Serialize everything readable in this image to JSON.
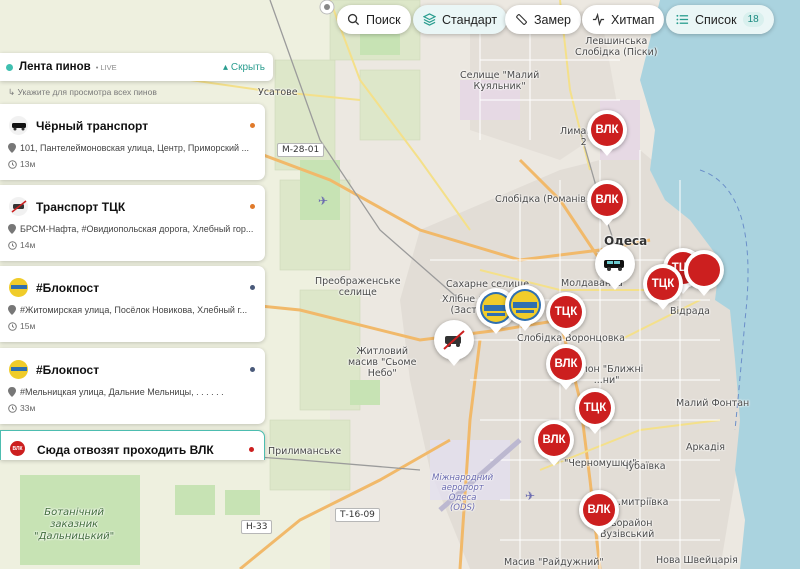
{
  "toolbar": {
    "search_label": "Поиск",
    "standard_label": "Стандарт",
    "measure_label": "Замер",
    "heatmap_label": "Хитмап",
    "list_label": "Список",
    "list_count": "18"
  },
  "feed": {
    "title": "Лента пинов",
    "live_label": "LIVE",
    "hide_label": "Скрыть",
    "hint": "Укажите для просмотра всех пинов",
    "cards": [
      {
        "title": "Чёрный транспорт",
        "address": "101, Пантелеймоновская улица, Центр, Приморский ...",
        "time": "13м",
        "status_color": "#e07a2b"
      },
      {
        "title": "Транспорт ТЦК",
        "address": "БРСМ-Нафта, #Овидиопольская дорога, Хлебный гор...",
        "time": "14м",
        "status_color": "#e07a2b"
      },
      {
        "title": "#Блокпост",
        "address": "#Житомирская улица, Посёлок Новикова, Хлебный г...",
        "time": "15м",
        "status_color": "#4a5a7a"
      },
      {
        "title": "#Блокпост",
        "address": "#Мельницкая улица, Дальние Мельницы, . . . . . .",
        "time": "33м",
        "status_color": "#4a5a7a"
      },
      {
        "title": "Сюда отвозят проходить ВЛК",
        "status_color": "#cc1f1f"
      }
    ]
  },
  "markers": [
    {
      "label": "ВЛК"
    },
    {
      "label": "ВЛК"
    },
    {
      "label": "ТЦК"
    },
    {
      "label": "ТЦК"
    },
    {
      "label": "ТЦК"
    },
    {
      "label": "ВЛК"
    },
    {
      "label": "ТЦК"
    },
    {
      "label": "ВЛК"
    },
    {
      "label": "ВЛК"
    }
  ],
  "map_labels": {
    "levshinka": "Левшинська\nСлобідка (Піски)",
    "maly_kuyalnyk": "Селище \"Малий\nКуяльник\"",
    "ustatove": "Усатове",
    "m2801": "М-28-01",
    "lymanchyk": "Лиманч...\n2",
    "slobidka": "Слобідка (Романів...",
    "odesa": "Одеса",
    "preobrazhenske": "Преображенське\nселище",
    "sakharne": "Сахарне селище",
    "khlibne": "Хлібне м...\n(Заст...",
    "moldavanka": "Молдаванка",
    "slobidka_vorontsovka": "Слобідка Воронцовка",
    "vidrada": "Відрада",
    "zhytlovyi": "Житловий\nмасив \"Сьоме\nНебо\"",
    "raion_blyzhni": "Район \"Ближні\n...ни\"",
    "malyi_fontan": "Малий Фонтан",
    "prylymanske": "Прилиманське",
    "chornomushky": "\"Черномушки\"",
    "chubaivka": "Чубаївка",
    "arkadiia": "Аркадія",
    "botanichnyi": "Ботанічний\nзаказник\n\"Дальницький\"",
    "airport": "Міжнародний\nаеропорт\nОдеса\n(ODS)",
    "t1609": "Т-16-09",
    "h33": "Н-33",
    "dmytrivka": "...митріївка",
    "rayon_vuzivsky": "...ьорайон\nВузівський",
    "raidyzhnyi": "Масив \"Райдужний\"",
    "nova_shveitsariia": "Нова Швейцарія"
  }
}
